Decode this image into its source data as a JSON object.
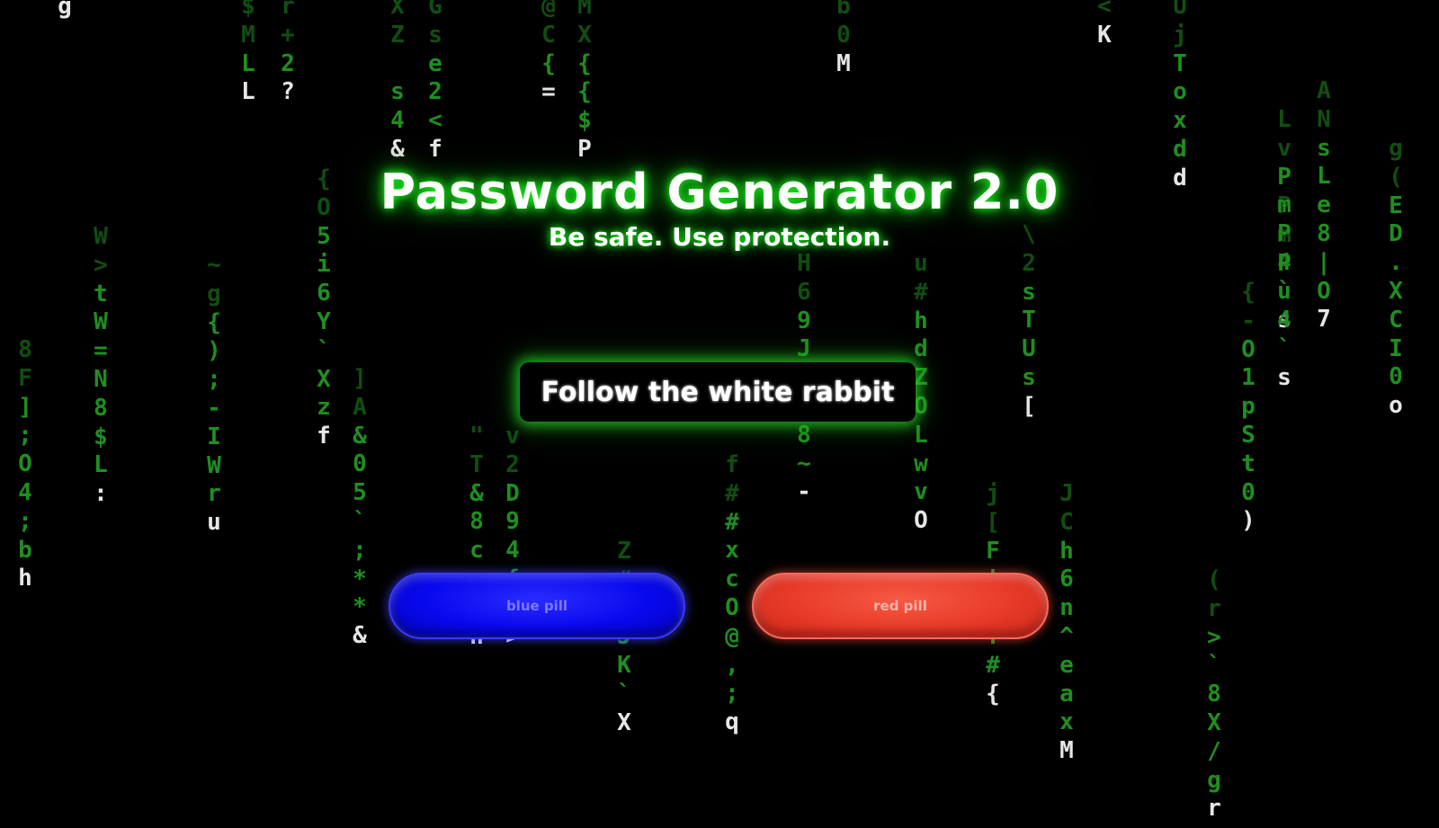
{
  "header": {
    "title": "Password Generator 2.0",
    "subtitle": "Be safe. Use protection."
  },
  "main": {
    "rabbit_button_label": "Follow the white rabbit",
    "blue_pill_label": "blue pill",
    "red_pill_label": "red pill"
  },
  "colors": {
    "rain_green": "#1f8f1f",
    "glow_green": "#1aff1a",
    "blue_pill": "#0808ee",
    "red_pill": "#e83a28"
  },
  "matrix_rain": [
    {
      "chars": [
        "g"
      ],
      "head": "g"
    },
    {
      "chars": [
        "$",
        "M",
        "L",
        "L"
      ]
    },
    {
      "chars": [
        "r",
        "+",
        "2",
        "?"
      ]
    },
    {
      "chars": [
        "X",
        "Z",
        "",
        "s",
        "4",
        "&"
      ]
    },
    {
      "chars": [
        "G",
        "s",
        "e",
        "2",
        "<",
        "f"
      ]
    },
    {
      "chars": [
        "@",
        "C",
        "{",
        "="
      ]
    },
    {
      "chars": [
        "M",
        "X",
        "{",
        "{",
        "$",
        "P"
      ]
    },
    {
      "chars": [
        "b",
        "0",
        "M"
      ]
    },
    {
      "chars": [
        "<",
        "K"
      ]
    },
    {
      "chars": [
        "U",
        "j",
        "T",
        "o",
        "x",
        "d",
        "d"
      ]
    },
    {
      "chars": [
        "A",
        "N",
        "s",
        "L",
        "e",
        "8",
        "|",
        "O",
        "7"
      ]
    },
    {
      "chars": [
        "W",
        ">",
        "t",
        "W",
        "=",
        "N",
        "8",
        "$",
        "L",
        ":"
      ]
    },
    {
      "chars": [
        "8",
        "F",
        "]",
        ";",
        "O",
        "4",
        ";",
        "b",
        "h"
      ]
    },
    {
      "chars": [
        "~",
        "g",
        "{",
        ")",
        ";",
        "-",
        "I",
        "W",
        "r",
        "u"
      ]
    },
    {
      "chars": [
        "{",
        "O",
        "5",
        "i",
        "6",
        "Y",
        "`",
        "X",
        "z",
        "f"
      ]
    },
    {
      "chars": [
        "]",
        "A",
        "&",
        "0",
        "5",
        "`",
        ";",
        "*",
        "*",
        "&"
      ]
    },
    {
      "chars": [
        "H",
        "6",
        "9",
        "J",
        "Z",
        "Z",
        "8",
        "~",
        "-"
      ]
    },
    {
      "chars": [
        "u",
        "#",
        "h",
        "d",
        "Z",
        "O",
        "L",
        "w",
        "v",
        "O"
      ]
    },
    {
      "chars": [
        "\\",
        "2",
        "s",
        "T",
        "U",
        "s",
        "["
      ]
    },
    {
      "chars": [
        "g",
        "(",
        "E",
        "D",
        ".",
        "X",
        "C",
        "I",
        "0",
        "o"
      ]
    },
    {
      "chars": [
        "L",
        "v",
        "P",
        "m",
        "P",
        "4",
        "`",
        "s"
      ]
    },
    {
      "chars": [
        "P",
        "m",
        "P",
        "u",
        "4",
        "`",
        "s"
      ]
    },
    {
      "chars": [
        "{",
        "-",
        "O",
        "1",
        "p",
        "S",
        "t",
        "0",
        ")"
      ]
    },
    {
      "chars": [
        "\"",
        "T",
        "&",
        "8",
        "c",
        "g",
        "T",
        "h"
      ]
    },
    {
      "chars": [
        "v",
        "2",
        "D",
        "9",
        "4",
        "{",
        "E",
        ">"
      ]
    },
    {
      "chars": [
        "Z",
        "#",
        "Z",
        "J",
        "K",
        "`",
        "X"
      ]
    },
    {
      "chars": [
        "f",
        "#",
        "#",
        "x",
        "c",
        "O",
        "@",
        ",",
        ";",
        "q"
      ]
    },
    {
      "chars": [
        "J",
        "C",
        "h",
        "6",
        "n",
        "^",
        "e",
        "a",
        "x",
        "M"
      ]
    },
    {
      "chars": [
        "j",
        "[",
        "F",
        "!",
        "v",
        "Y",
        "#",
        "{"
      ]
    },
    {
      "chars": [
        "(",
        "r",
        ">",
        "`",
        "8",
        "X",
        "/",
        "g",
        "r"
      ]
    }
  ]
}
